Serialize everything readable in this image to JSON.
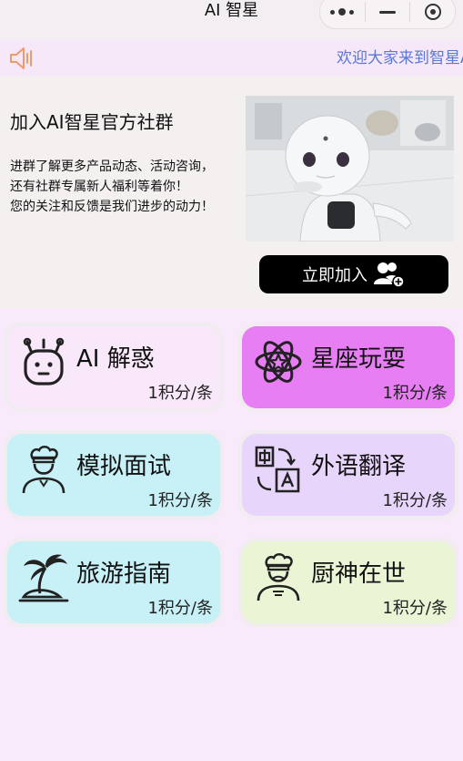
{
  "app": {
    "title": "AI 智星"
  },
  "notice": {
    "text": "欢迎大家来到智星AI"
  },
  "community": {
    "heading": "加入AI智星官方社群",
    "lines": [
      "进群了解更多产品动态、活动咨询，",
      "还有社群专属新人福利等着你！",
      "您的关注和反馈是我们进步的动力！"
    ],
    "join_label": "立即加入"
  },
  "features": [
    {
      "name": "AI 解惑",
      "cost": "1积分/条",
      "color": "#f9e8fa",
      "icon": "robot-face-icon"
    },
    {
      "name": "星座玩耍",
      "cost": "1积分/条",
      "color": "#e77ef4",
      "icon": "atom-star-icon"
    },
    {
      "name": "模拟面试",
      "cost": "1积分/条",
      "color": "#c8f0f7",
      "icon": "chef-person-icon"
    },
    {
      "name": "外语翻译",
      "cost": "1积分/条",
      "color": "#e8d5fb",
      "icon": "translate-icon"
    },
    {
      "name": "旅游指南",
      "cost": "1积分/条",
      "color": "#c8f0f7",
      "icon": "palm-island-icon"
    },
    {
      "name": "厨神在世",
      "cost": "1积分/条",
      "color": "#eaf5d6",
      "icon": "chef-icon"
    }
  ]
}
